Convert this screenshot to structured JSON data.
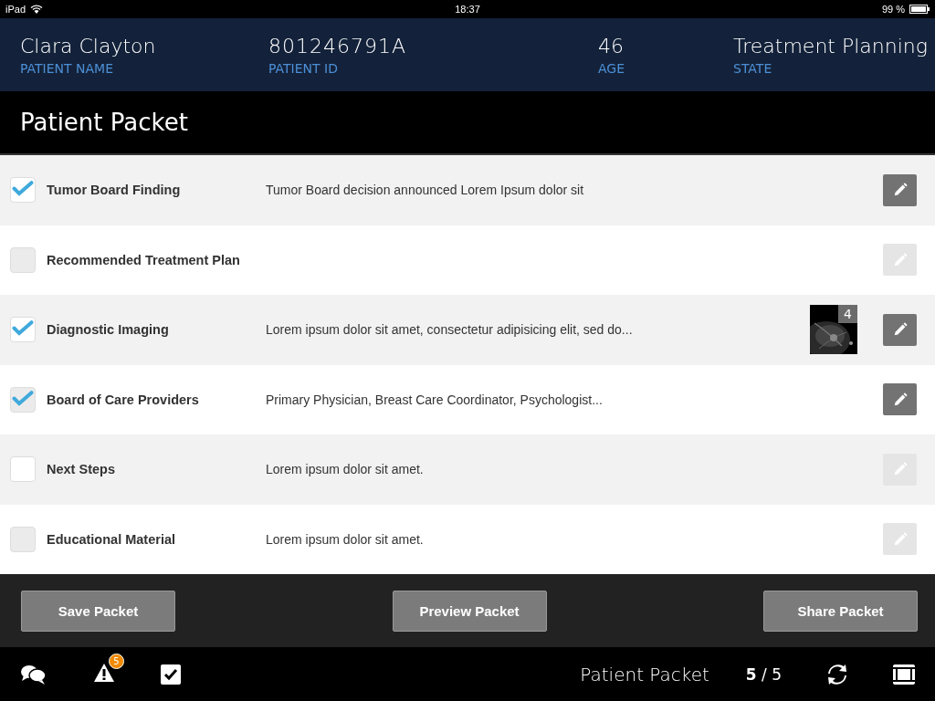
{
  "status_bar": {
    "device": "iPad",
    "time": "18:37",
    "battery": "99 %"
  },
  "patient": [
    {
      "value": "Clara Clayton",
      "label": "PATIENT NAME"
    },
    {
      "value": "801246791A",
      "label": "PATIENT ID"
    },
    {
      "value": "46",
      "label": "AGE"
    },
    {
      "value": "Treatment Planning",
      "label": "STATE"
    }
  ],
  "title": "Patient Packet",
  "rows": [
    {
      "name": "Tumor Board Finding",
      "description": "Tumor Board decision announced Lorem Ipsum dolor sit",
      "checked": true,
      "disabled": false,
      "edit_enabled": true
    },
    {
      "name": "Recommended Treatment Plan",
      "checked": false,
      "disabled": true,
      "edit_enabled": false
    },
    {
      "name": "Diagnostic Imaging",
      "description": "Lorem ipsum dolor sit amet, consectetur adipisicing elit, sed do...",
      "checked": true,
      "disabled": false,
      "edit_enabled": true,
      "image_count": "4"
    },
    {
      "name": "Board of Care Providers",
      "description": "Primary Physician, Breast Care Coordinator, Psychologist...",
      "checked": true,
      "disabled": true,
      "edit_enabled": true
    },
    {
      "name": "Next Steps",
      "description": "Lorem ipsum dolor sit amet.",
      "checked": false,
      "disabled": false,
      "edit_enabled": false
    },
    {
      "name": "Educational Material",
      "description": "Lorem ipsum dolor sit amet.",
      "checked": false,
      "disabled": true,
      "edit_enabled": false
    }
  ],
  "buttons": [
    "Save Packet",
    "Preview Packet",
    "Share Packet"
  ],
  "bottom_bar": {
    "alert_count": "5",
    "title": "Patient Packet",
    "page": "**5** / 5"
  }
}
